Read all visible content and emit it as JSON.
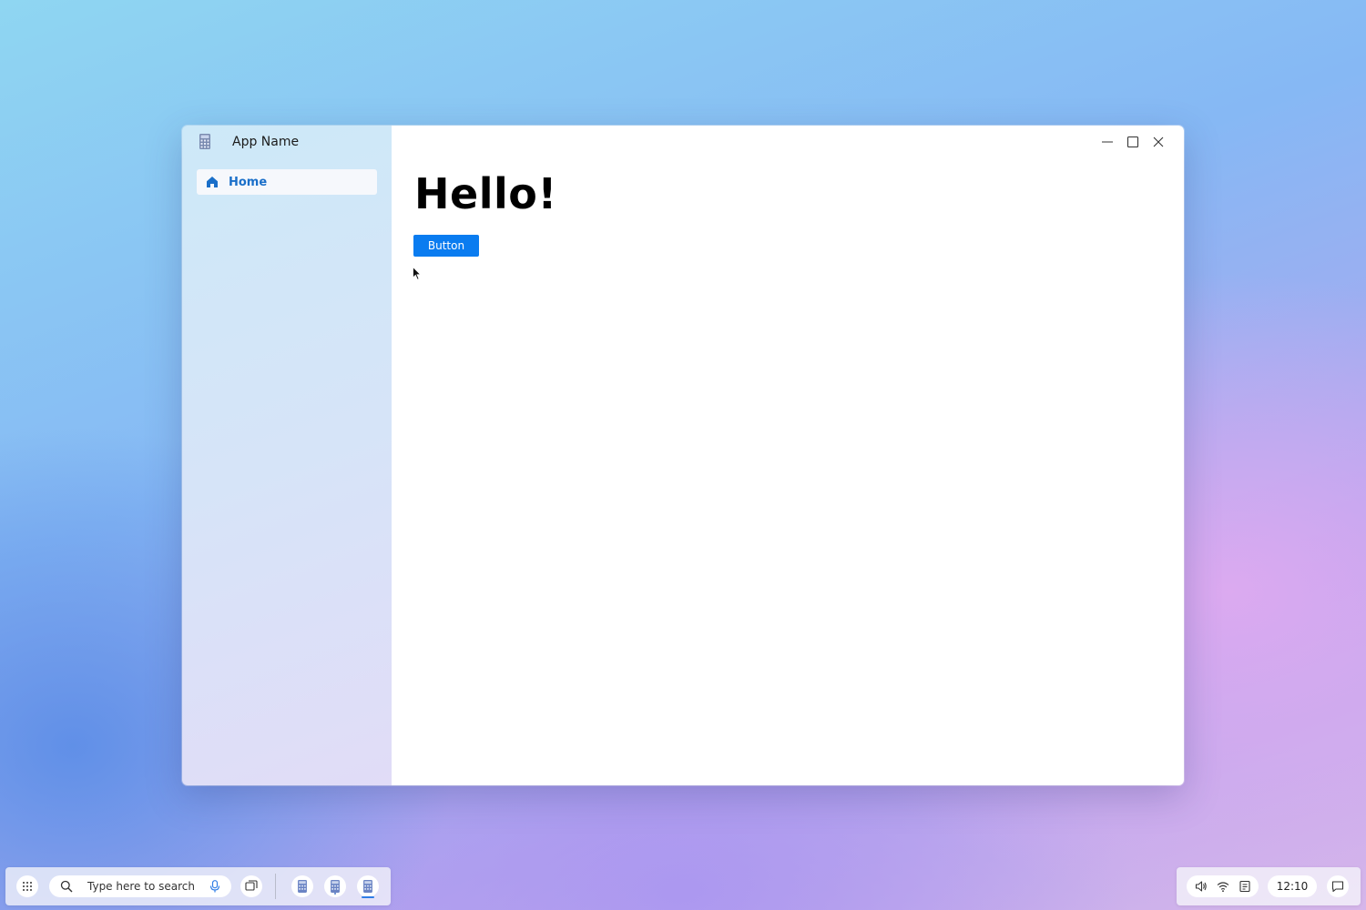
{
  "app": {
    "title": "App Name",
    "nav": [
      {
        "label": "Home",
        "icon": "home-icon",
        "selected": true
      }
    ]
  },
  "main": {
    "heading": "Hello!",
    "button_label": "Button"
  },
  "window_controls": [
    "minimize-icon",
    "maximize-icon",
    "close-icon"
  ],
  "taskbar": {
    "search_placeholder": "Type here to search",
    "pinned_apps": [
      "calculator-app-icon",
      "calculator-app-icon",
      "calculator-app-icon"
    ],
    "clock": "12:10",
    "tray_icons": [
      "volume-icon",
      "wifi-icon",
      "clipboard-icon"
    ]
  },
  "colors": {
    "accent": "#0a7cf0",
    "nav_text": "#1a6fc9"
  }
}
